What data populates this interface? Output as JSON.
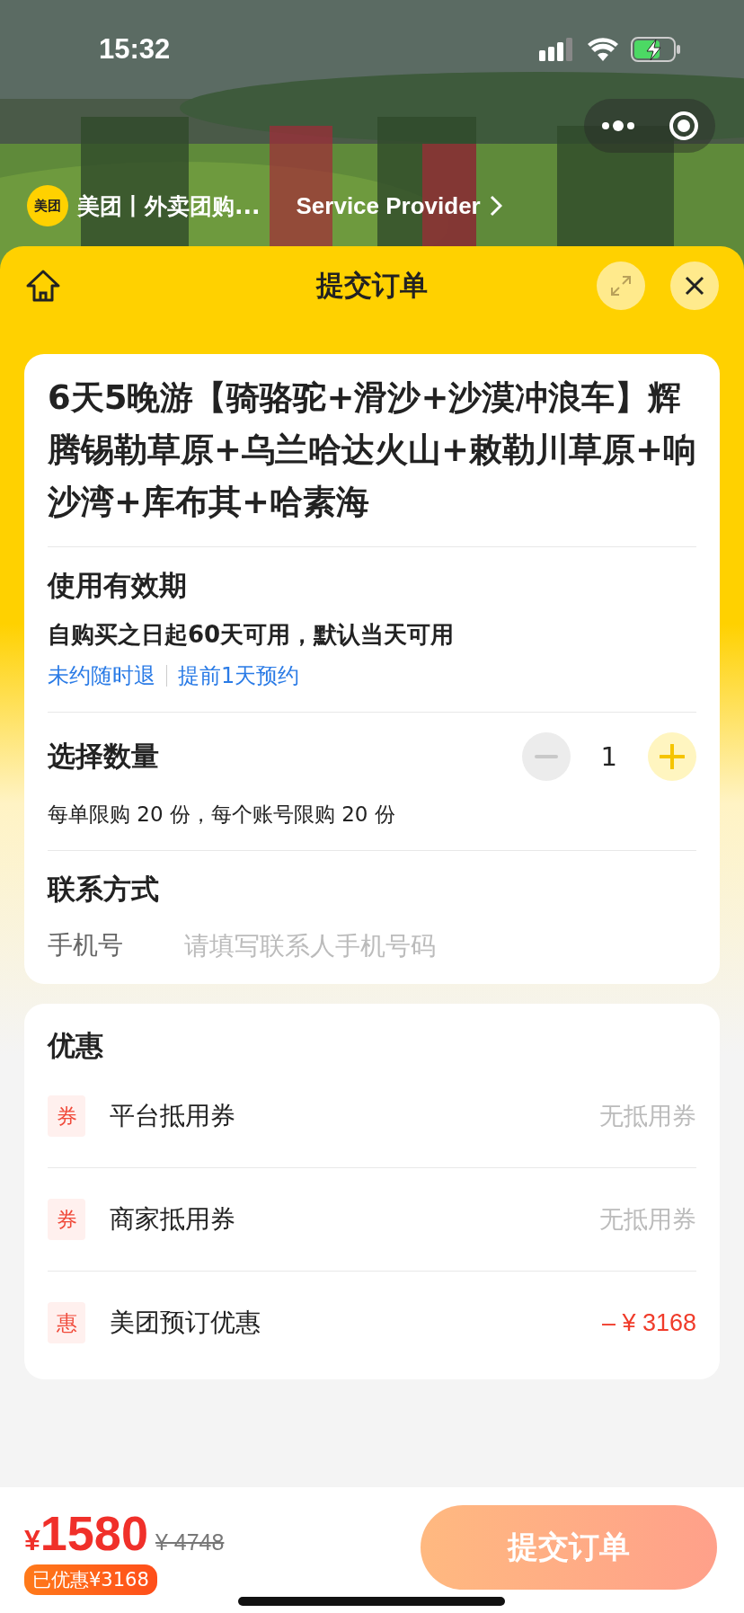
{
  "status_bar": {
    "time": "15:32"
  },
  "mini_program": {
    "logo": "美团",
    "name": "美团丨外卖团购...",
    "provider": "Service Provider"
  },
  "sheet": {
    "title": "提交订单"
  },
  "product": {
    "title": "6天5晚游【骑骆驼+滑沙+沙漠冲浪车】辉腾锡勒草原+乌兰哈达火山+敕勒川草原+响沙湾+库布其+哈素海"
  },
  "validity": {
    "heading": "使用有效期",
    "text": "自购买之日起60天可用，默认当天可用",
    "tags": [
      "未约随时退",
      "提前1天预约"
    ]
  },
  "quantity": {
    "heading": "选择数量",
    "value": "1",
    "minus_disabled": true,
    "plus_disabled": false,
    "limit": "每单限购 20 份，每个账号限购 20 份"
  },
  "contact": {
    "heading": "联系方式",
    "label": "手机号",
    "placeholder": "请填写联系人手机号码"
  },
  "discounts": {
    "heading": "优惠",
    "rows": [
      {
        "badge": "券",
        "label": "平台抵用券",
        "value": "无抵用券",
        "kind": "empty"
      },
      {
        "badge": "券",
        "label": "商家抵用券",
        "value": "无抵用券",
        "kind": "empty"
      },
      {
        "badge": "惠",
        "label": "美团预订优惠",
        "value": "– ¥ 3168",
        "kind": "amount"
      }
    ]
  },
  "footer": {
    "currency": "¥",
    "price": "1580",
    "original_price": "¥ 4748",
    "saved": "已优惠¥3168",
    "submit": "提交订单",
    "submit_disabled": true
  }
}
